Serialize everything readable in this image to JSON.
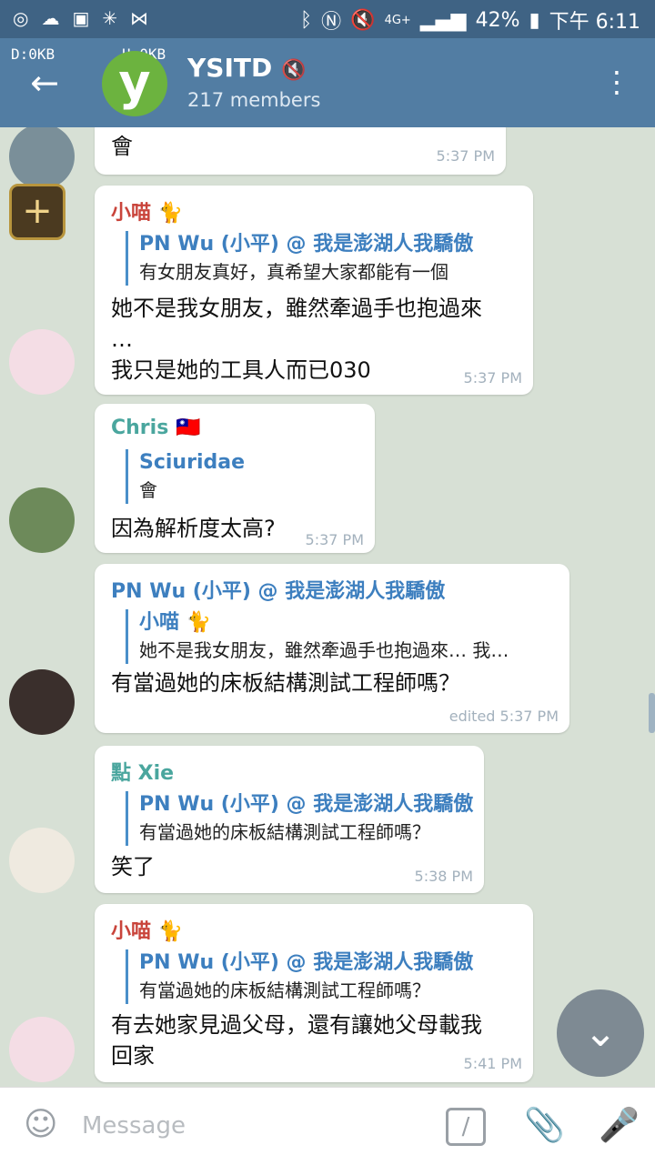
{
  "status": {
    "network_up": "U:0KB",
    "network_down": "D:0KB",
    "lte": "4G+",
    "battery": "42%",
    "time": "下午 6:11"
  },
  "header": {
    "title": "YSITD",
    "members": "217 members",
    "avatar_letter": "y"
  },
  "messages": [
    {
      "text": "會",
      "time": "5:37 PM"
    },
    {
      "sender": "小喵",
      "reply_name": "PN Wu (小平) @ 我是澎湖人我驕傲",
      "reply_text": "有女朋友真好，真希望大家都能有一個",
      "line1": "她不是我女朋友，雖然牽過手也抱過來",
      "line2": "…",
      "line3": "我只是她的工具人而已030",
      "time": "5:37 PM"
    },
    {
      "sender": "Chris 🇹🇼",
      "reply_name": "Sciuridae",
      "reply_text": "會",
      "text": "因為解析度太高?",
      "time": "5:37 PM"
    },
    {
      "sender": "PN Wu (小平) @ 我是澎湖人我驕傲",
      "reply_name": "小喵 🐈",
      "reply_text": "她不是我女朋友，雖然牽過手也抱過來… 我…",
      "text": "有當過她的床板結構測試工程師嗎？",
      "time": "edited 5:37 PM"
    },
    {
      "sender": "點 Xie",
      "reply_name": "PN Wu (小平) @ 我是澎湖人我驕傲",
      "reply_text": "有當過她的床板結構測試工程師嗎？",
      "text": "笑了",
      "time": "5:38 PM"
    },
    {
      "sender": "小喵",
      "reply_name": "PN Wu (小平) @ 我是澎湖人我驕傲",
      "reply_text": "有當過她的床板結構測試工程師嗎？",
      "line1": "有去她家見過父母，還有讓她父母載我",
      "line2": "回家",
      "time": "5:41 PM"
    }
  ],
  "input": {
    "placeholder": "Message"
  },
  "colors": {
    "header": "#527da3",
    "status_bar": "#3f6384",
    "name_red": "#c9443b",
    "name_teal": "#4aa69e",
    "name_blue": "#3d7fbf"
  }
}
